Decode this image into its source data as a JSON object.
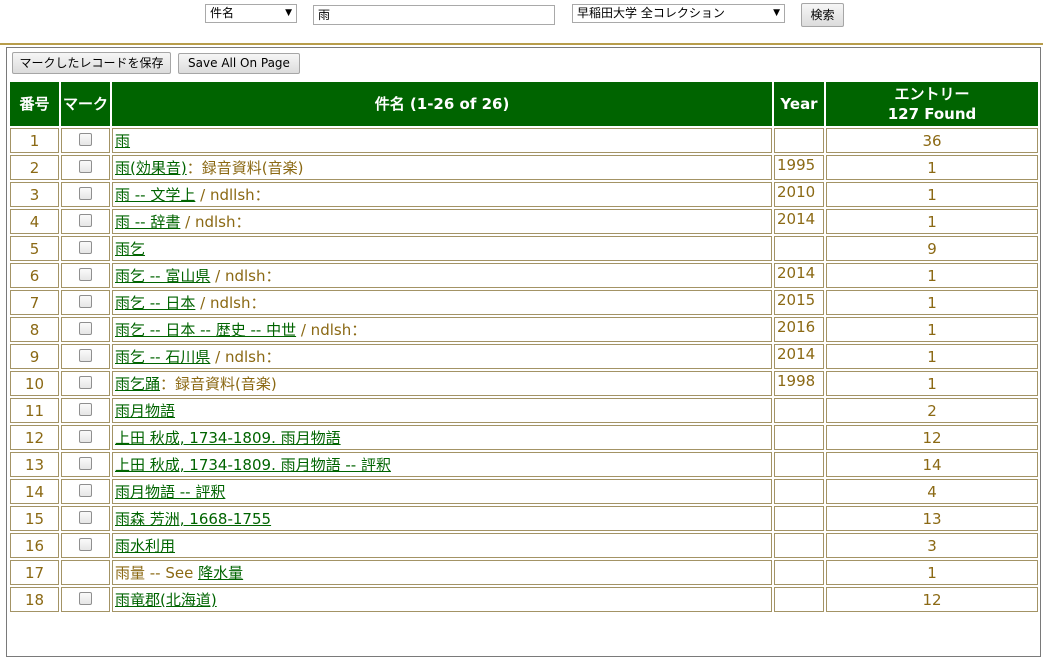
{
  "search": {
    "field_select": "件名",
    "query": "雨",
    "collection_select": "早稲田大学 全コレクション",
    "search_button": "検索"
  },
  "actions": {
    "save_marked": "マークしたレコードを保存",
    "save_all": "Save All On Page"
  },
  "table": {
    "headers": {
      "number": "番号",
      "mark": "マーク",
      "title": "件名 (1-26 of 26)",
      "year": "Year",
      "entries_line1": "エントリー",
      "entries_line2": "127 Found"
    },
    "rows": [
      {
        "num": "1",
        "checkbox": true,
        "link": "雨",
        "suffix": "",
        "year": "",
        "count": "36"
      },
      {
        "num": "2",
        "checkbox": true,
        "link": "雨(効果音)",
        "suffix": "：録音資料(音楽)",
        "year": "1995",
        "count": "1"
      },
      {
        "num": "3",
        "checkbox": true,
        "link": "雨 -- 文学上",
        "suffix": " / ndllsh：",
        "year": "2010",
        "count": "1"
      },
      {
        "num": "4",
        "checkbox": true,
        "link": "雨 -- 辞書",
        "suffix": " / ndlsh：",
        "year": "2014",
        "count": "1"
      },
      {
        "num": "5",
        "checkbox": true,
        "link": "雨乞",
        "suffix": "",
        "year": "",
        "count": "9"
      },
      {
        "num": "6",
        "checkbox": true,
        "link": "雨乞 -- 富山県",
        "suffix": " / ndlsh：",
        "year": "2014",
        "count": "1"
      },
      {
        "num": "7",
        "checkbox": true,
        "link": "雨乞 -- 日本",
        "suffix": " / ndlsh：",
        "year": "2015",
        "count": "1"
      },
      {
        "num": "8",
        "checkbox": true,
        "link": "雨乞 -- 日本 -- 歴史 -- 中世",
        "suffix": " / ndlsh：",
        "year": "2016",
        "count": "1"
      },
      {
        "num": "9",
        "checkbox": true,
        "link": "雨乞 -- 石川県",
        "suffix": " / ndlsh：",
        "year": "2014",
        "count": "1"
      },
      {
        "num": "10",
        "checkbox": true,
        "link": "雨乞踊",
        "suffix": "：録音資料(音楽)",
        "year": "1998",
        "count": "1"
      },
      {
        "num": "11",
        "checkbox": true,
        "link": "雨月物語",
        "suffix": "",
        "year": "",
        "count": "2"
      },
      {
        "num": "12",
        "checkbox": true,
        "link": "上田 秋成, 1734-1809. 雨月物語",
        "suffix": "",
        "year": "",
        "count": "12"
      },
      {
        "num": "13",
        "checkbox": true,
        "link": "上田 秋成, 1734-1809. 雨月物語 -- 評釈",
        "suffix": "",
        "year": "",
        "count": "14"
      },
      {
        "num": "14",
        "checkbox": true,
        "link": "雨月物語 -- 評釈",
        "suffix": "",
        "year": "",
        "count": "4"
      },
      {
        "num": "15",
        "checkbox": true,
        "link": "雨森 芳洲, 1668-1755",
        "suffix": "",
        "year": "",
        "count": "13"
      },
      {
        "num": "16",
        "checkbox": true,
        "link": "雨水利用",
        "suffix": "",
        "year": "",
        "count": "3"
      },
      {
        "num": "17",
        "checkbox": false,
        "prefix": "雨量 -- See ",
        "link": "降水量",
        "suffix": "",
        "year": "",
        "count": "1"
      },
      {
        "num": "18",
        "checkbox": true,
        "link": "雨竜郡(北海道)",
        "suffix": "",
        "year": "",
        "count": "12"
      }
    ]
  },
  "colors": {
    "header_bg": "#006400",
    "link": "#006400",
    "cell_text": "#8b6914",
    "cell_border": "#a39365"
  }
}
